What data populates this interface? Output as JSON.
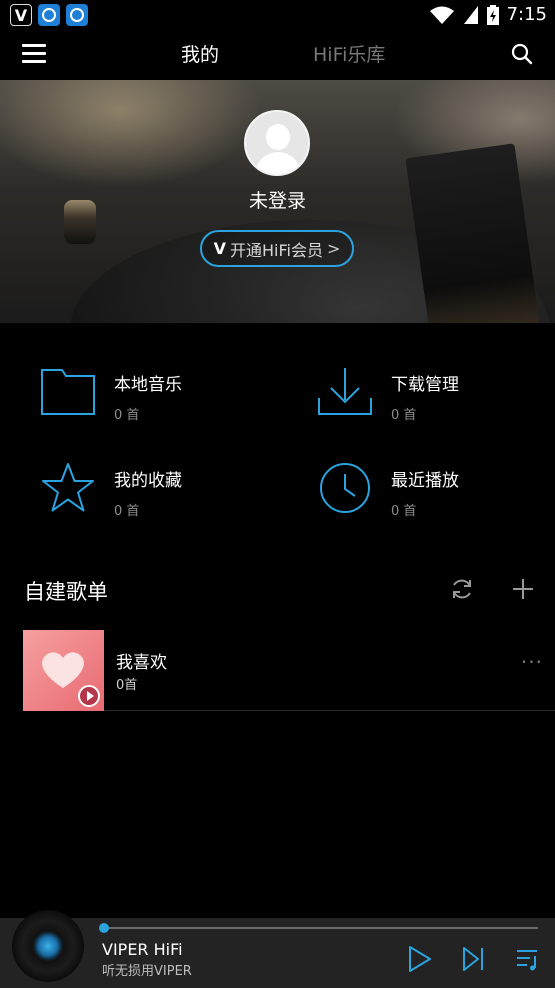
{
  "status_bar": {
    "time": "7:15",
    "app_icons": [
      "viper-icon",
      "app-badge-icon",
      "app-badge-icon"
    ]
  },
  "header": {
    "tabs": [
      {
        "label": "我的",
        "active": true
      },
      {
        "label": "HiFi乐库",
        "active": false
      }
    ],
    "icons": {
      "menu": "hamburger-menu-icon",
      "search": "search-icon"
    }
  },
  "profile": {
    "login_status": "未登录",
    "vip_button_label": "开通HiFi会员",
    "vip_logo": "V"
  },
  "library": [
    {
      "title": "本地音乐",
      "count": "0 首",
      "icon": "folder-icon"
    },
    {
      "title": "下载管理",
      "count": "0 首",
      "icon": "download-icon"
    },
    {
      "title": "我的收藏",
      "count": "0 首",
      "icon": "star-icon"
    },
    {
      "title": "最近播放",
      "count": "0 首",
      "icon": "clock-icon"
    }
  ],
  "playlists_section": {
    "title": "自建歌单",
    "items": [
      {
        "name": "我喜欢",
        "count": "0首",
        "more": "···"
      }
    ]
  },
  "player": {
    "title": "VIPER HiFi",
    "subtitle": "听无损用VIPER",
    "progress": 0.0
  },
  "colors": {
    "accent": "#2aa3df",
    "background": "#000000",
    "player_bg": "#232323",
    "muted_text": "#8c8c8c"
  }
}
